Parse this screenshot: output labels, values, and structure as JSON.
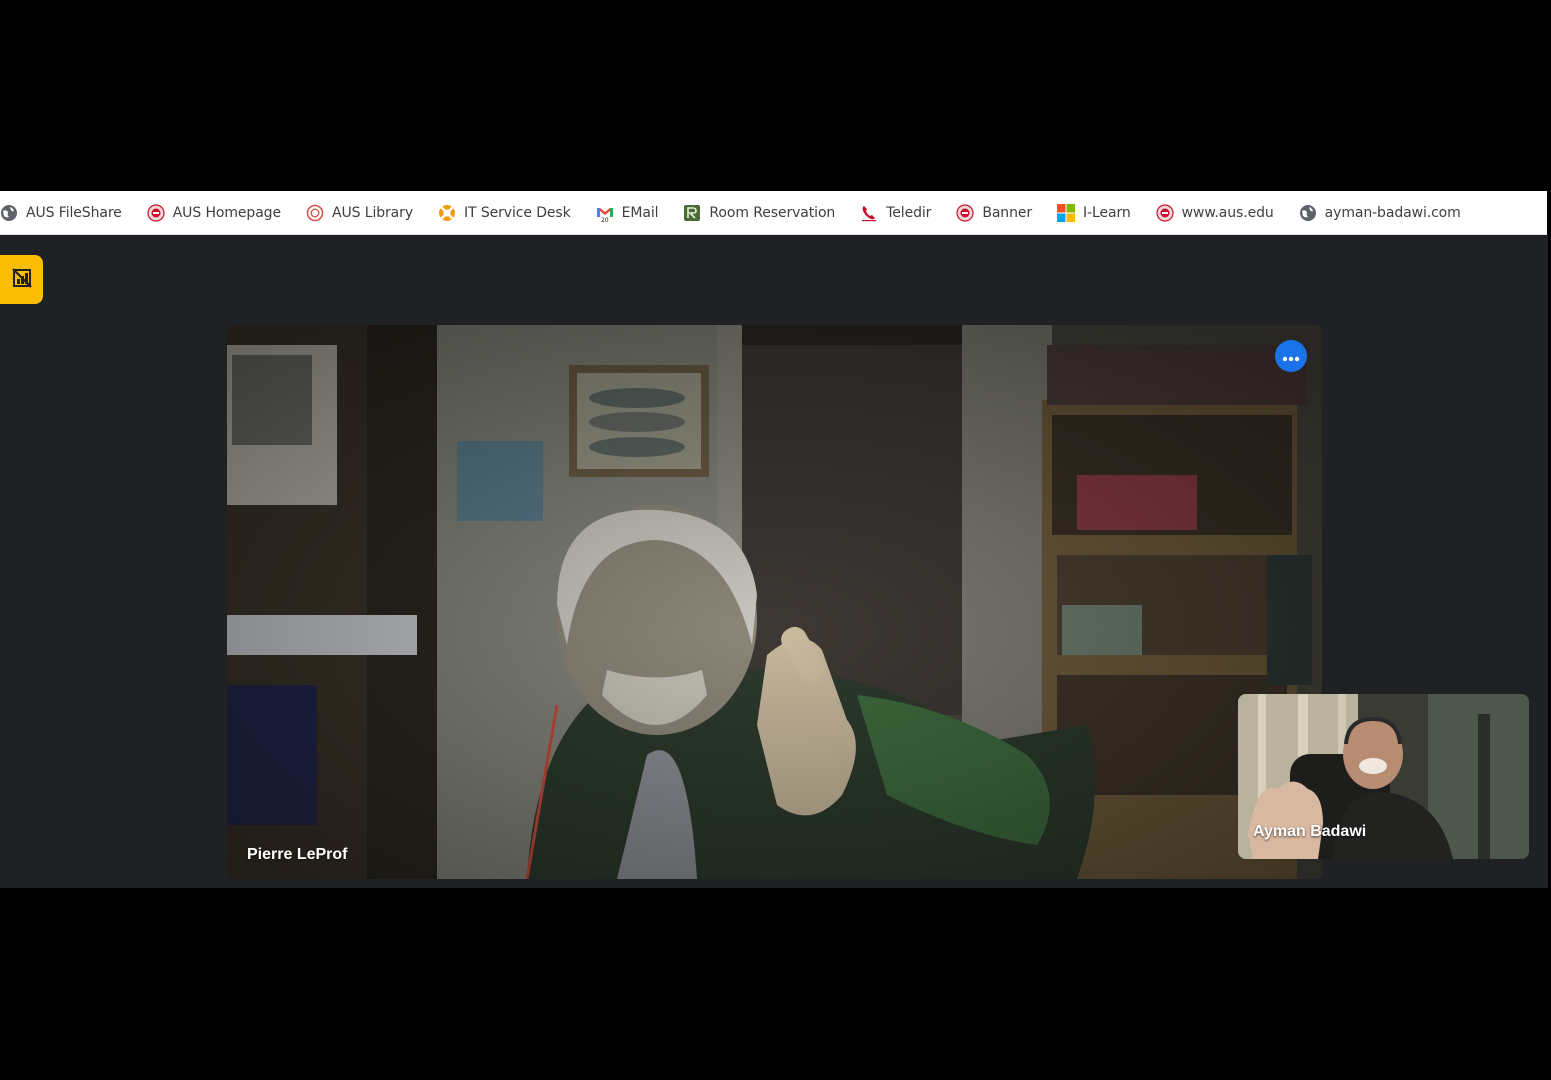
{
  "bookmarks": [
    {
      "label": "AUS FileShare",
      "icon": "globe-icon"
    },
    {
      "label": "AUS Homepage",
      "icon": "aus-seal-icon"
    },
    {
      "label": "AUS Library",
      "icon": "library-ring-icon"
    },
    {
      "label": "IT Service Desk",
      "icon": "lifebuoy-icon"
    },
    {
      "label": "EMail",
      "icon": "gmail-icon"
    },
    {
      "label": "Room Reservation",
      "icon": "reservation-icon"
    },
    {
      "label": "Teledir",
      "icon": "phone-icon"
    },
    {
      "label": "Banner",
      "icon": "aus-seal-icon"
    },
    {
      "label": "I-Learn",
      "icon": "microsoft-icon"
    },
    {
      "label": "www.aus.edu",
      "icon": "aus-seal-icon"
    },
    {
      "label": "ayman-badawi.com",
      "icon": "globe-icon"
    }
  ],
  "meeting": {
    "main_participant": "Pierre LeProf",
    "self_view_participant": "Ayman Badawi",
    "accent_color": "#1a73e8",
    "badge_color": "#fbbc04"
  }
}
